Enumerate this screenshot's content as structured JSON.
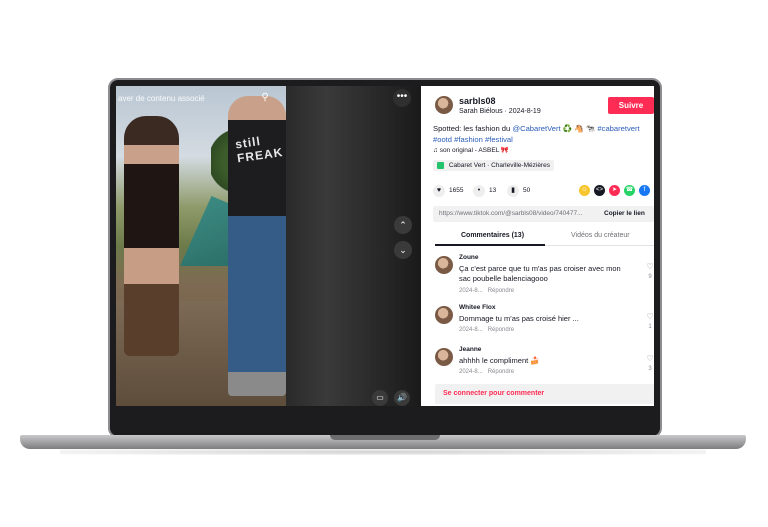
{
  "video": {
    "search_text": "aver de contenu associé",
    "shirt_text": "still FREAK"
  },
  "post": {
    "username": "sarbls08",
    "display_name_date": "Sarah Biélous · 2024-8-19",
    "follow_label": "Suivre",
    "caption_prefix": "Spotted: les fashion du ",
    "caption_mention": "@CabaretVert",
    "caption_emojis": " ♻️ 🐴 🐄 ",
    "caption_tag1": "#cabaretvert",
    "caption_tag2": "#ootd",
    "caption_tag3": "#fashion",
    "caption_tag4": "#festival",
    "music": "son original - ASBEL 🎀",
    "location": "Cabaret Vert · Charleville-Mézières",
    "likes": "1655",
    "comments": "13",
    "saves": "50"
  },
  "link": {
    "url": "https://www.tiktok.com/@sarbls08/video/740477...",
    "copy_label": "Copier le lien"
  },
  "tabs": {
    "comments": "Commentaires (13)",
    "creator_videos": "Vidéos du créateur"
  },
  "comments": [
    {
      "user": "Zoune",
      "text": "Ça c'est parce que tu m'as pas croiser avec mon sac poubelle balenciagooo",
      "date": "2024-8...",
      "reply": "Répondre",
      "likes": "9"
    },
    {
      "user": "Whitee Flox",
      "text": "Dommage tu m'as pas croisé hier ...",
      "date": "2024-8...",
      "reply": "Répondre",
      "likes": "1"
    },
    {
      "user": "Jeanne",
      "text": "ahhhh le compliment 🍰",
      "date": "2024-8...",
      "reply": "Répondre",
      "likes": "3"
    }
  ],
  "login_prompt": "Se connecter pour commenter",
  "colors": {
    "accent": "#fe2c55",
    "link": "#2b5db9",
    "text": "#161823"
  }
}
